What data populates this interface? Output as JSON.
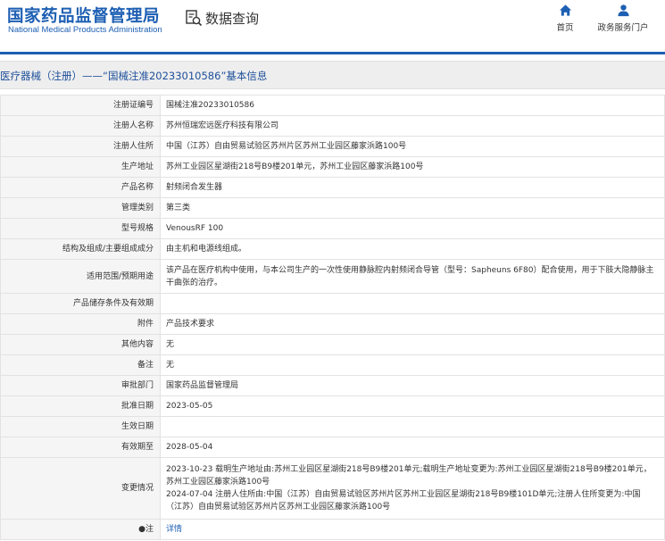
{
  "header": {
    "logo_cn": "国家药品监督管理局",
    "logo_en": "National Medical Products Administration",
    "query_label": "数据查询",
    "nav": [
      {
        "label": "首页",
        "icon": "home-icon"
      },
      {
        "label": "政务服务门户",
        "icon": "user-icon"
      }
    ]
  },
  "title": "医疗器械（注册）——“国械注准20233010586”基本信息",
  "rows": [
    {
      "label": "注册证编号",
      "value": "国械注准20233010586"
    },
    {
      "label": "注册人名称",
      "value": "苏州恒瑞宏远医疗科技有限公司"
    },
    {
      "label": "注册人住所",
      "value": "中国（江苏）自由贸易试验区苏州片区苏州工业园区藤家浜路100号"
    },
    {
      "label": "生产地址",
      "value": "苏州工业园区星湖街218号B9楼201单元，苏州工业园区藤家浜路100号"
    },
    {
      "label": "产品名称",
      "value": "射频闭合发生器"
    },
    {
      "label": "管理类别",
      "value": "第三类"
    },
    {
      "label": "型号规格",
      "value": "VenousRF 100"
    },
    {
      "label": "结构及组成/主要组成成分",
      "value": "由主机和电源线组成。"
    },
    {
      "label": "适用范围/预期用途",
      "value": "该产品在医疗机构中使用，与本公司生产的一次性使用静脉腔内射频闭合导管（型号：Sapheuns 6F80）配合使用，用于下肢大隐静脉主干曲张的治疗。"
    },
    {
      "label": "产品储存条件及有效期",
      "value": ""
    },
    {
      "label": "附件",
      "value": "产品技术要求"
    },
    {
      "label": "其他内容",
      "value": "无"
    },
    {
      "label": "备注",
      "value": "无"
    },
    {
      "label": "审批部门",
      "value": "国家药品监督管理局"
    },
    {
      "label": "批准日期",
      "value": "2023-05-05"
    },
    {
      "label": "生效日期",
      "value": ""
    },
    {
      "label": "有效期至",
      "value": "2028-05-04"
    },
    {
      "label": "变更情况",
      "value": "2023-10-23 载明生产地址由:苏州工业园区星湖街218号B9楼201单元;载明生产地址变更为:苏州工业园区星湖街218号B9楼201单元，苏州工业园区藤家浜路100号\n2024-07-04 注册人住所由:中国（江苏）自由贸易试验区苏州片区苏州工业园区星湖街218号B9楼101D单元;注册人住所变更为:中国（江苏）自由贸易试验区苏州片区苏州工业园区藤家浜路100号"
    },
    {
      "label": "●注",
      "value": "详情",
      "link": true
    }
  ]
}
